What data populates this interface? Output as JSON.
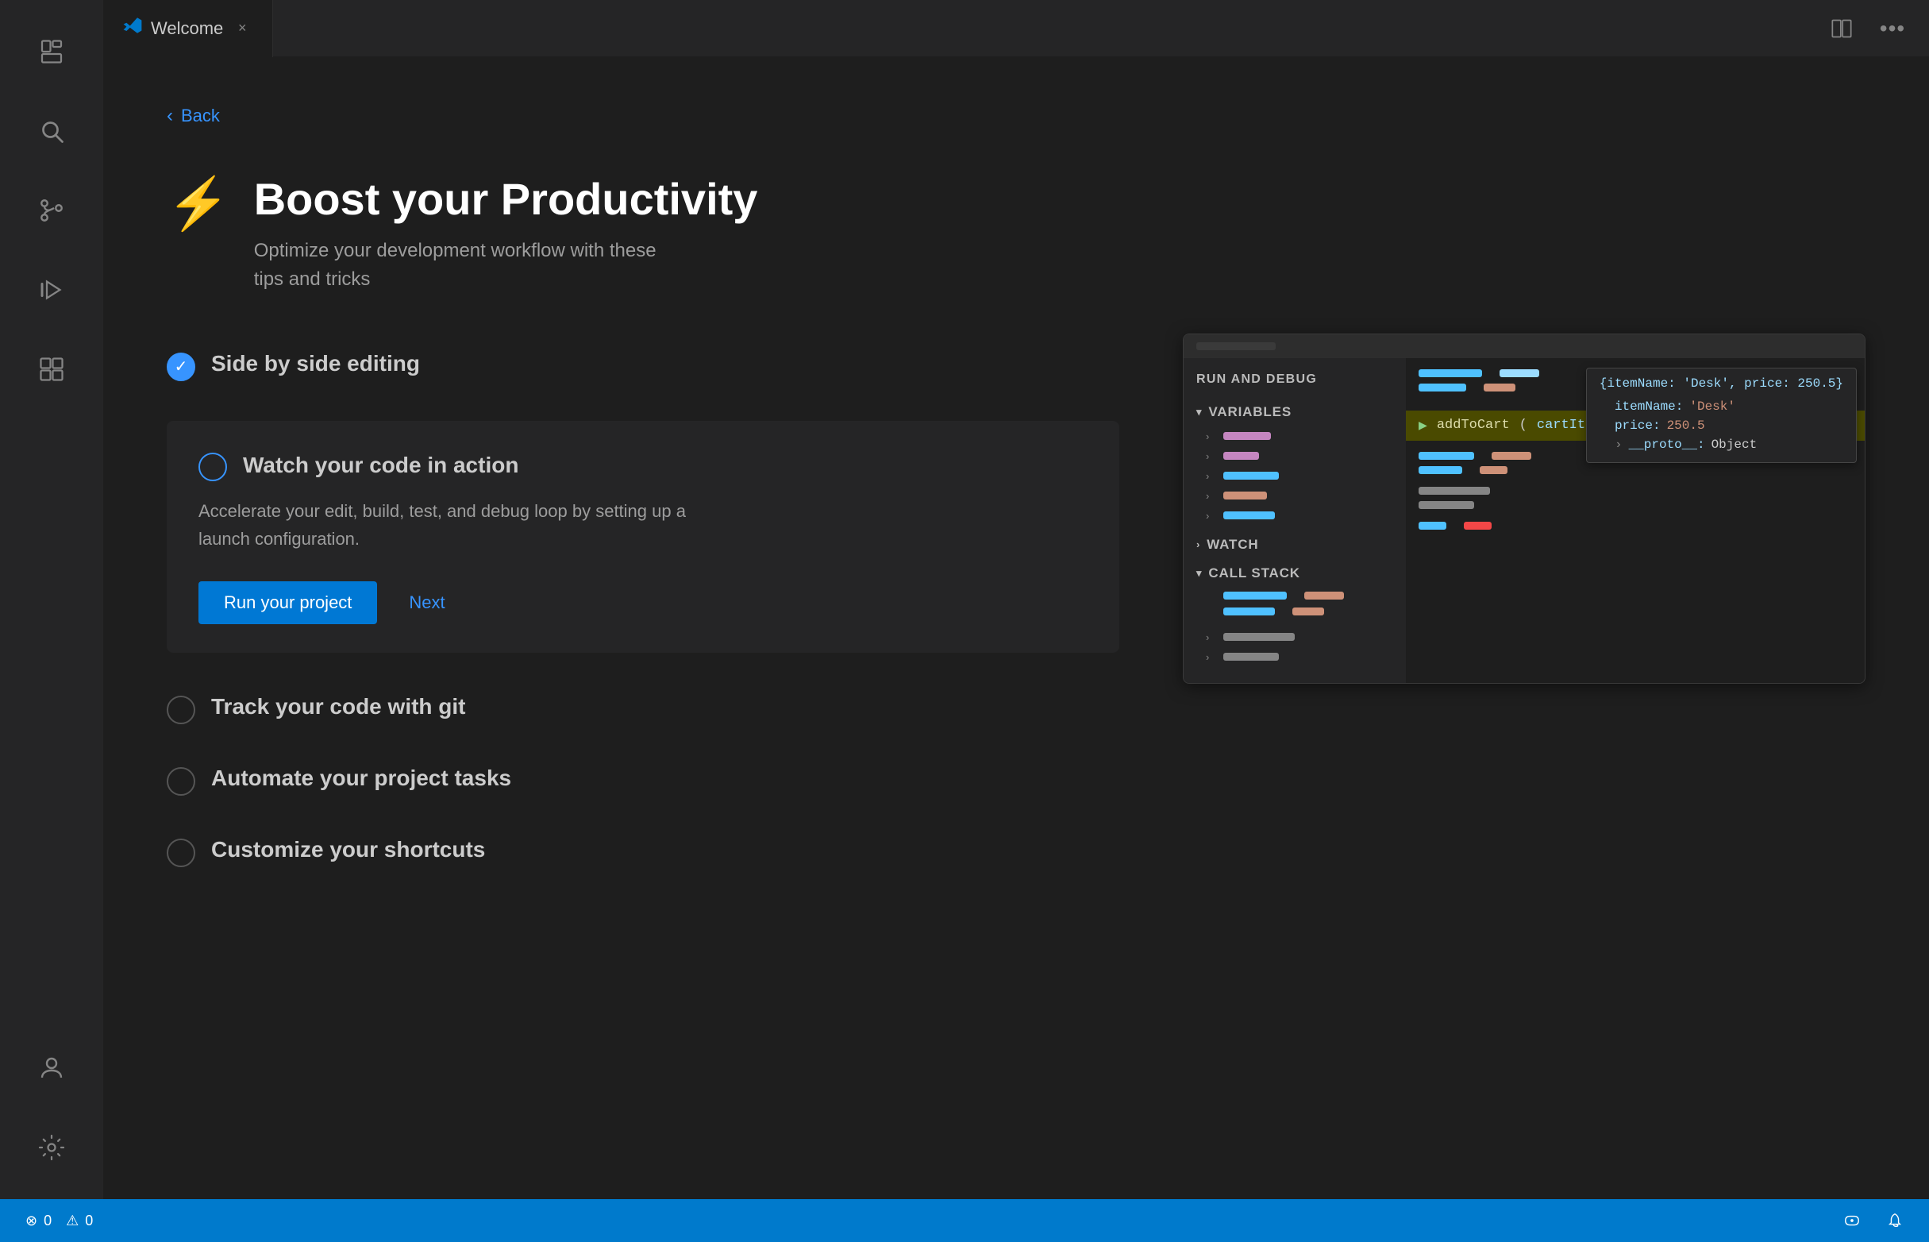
{
  "tab": {
    "icon": "⚡",
    "title": "Welcome",
    "close_label": "×"
  },
  "toolbar": {
    "split_editor": "⊟",
    "more_actions": "⋯"
  },
  "back_link": "Back",
  "page": {
    "icon": "⚡",
    "title": "Boost your Productivity",
    "subtitle_line1": "Optimize your development workflow with these",
    "subtitle_line2": "tips and tricks"
  },
  "checklist": {
    "items": [
      {
        "id": "side-by-side",
        "label": "Side by side editing",
        "checked": true,
        "expanded": false
      },
      {
        "id": "watch-code",
        "label": "Watch your code in action",
        "checked": false,
        "expanded": true,
        "description": "Accelerate your edit, build, test, and debug loop by setting up a\nlaunch configuration.",
        "primary_action": "Run your project",
        "secondary_action": "Next"
      },
      {
        "id": "track-git",
        "label": "Track your code with git",
        "checked": false,
        "expanded": false
      },
      {
        "id": "automate",
        "label": "Automate your project tasks",
        "checked": false,
        "expanded": false
      },
      {
        "id": "shortcuts",
        "label": "Customize your shortcuts",
        "checked": false,
        "expanded": false
      }
    ]
  },
  "debug_panel": {
    "sections": [
      {
        "name": "VARIABLES",
        "vars": [
          {
            "color": "purple",
            "width": 60
          },
          {
            "color": "purple",
            "width": 45
          },
          {
            "color": "blue",
            "width": 70
          },
          {
            "color": "orange",
            "width": 55
          },
          {
            "color": "blue",
            "width": 65
          }
        ]
      },
      {
        "name": "WATCH"
      },
      {
        "name": "CALL STACK",
        "vars": [
          {
            "color": "blue",
            "width": 80,
            "width2": 60,
            "color2": "orange"
          },
          {
            "color": "blue",
            "width": 70,
            "width2": 50,
            "color2": "orange"
          }
        ]
      }
    ],
    "tooltip": {
      "title": "{itemName: 'Desk', price: 250.5}",
      "rows": [
        {
          "key": "itemName:",
          "val": "'Desk'"
        },
        {
          "key": "price:",
          "val": "250.5"
        },
        {
          "key": "__proto__:",
          "val": "Object"
        }
      ]
    },
    "highlight_line": "addToCart(cartItem);",
    "call_stack_lines": [
      {
        "color1": "blue",
        "w1": 80,
        "color2": "orange",
        "w2": 60
      },
      {
        "color1": "blue",
        "w1": 70,
        "color2": "orange",
        "w2": 50
      }
    ],
    "extra_lines": [
      {
        "color1": "gray",
        "w1": 100
      },
      {
        "color1": "gray",
        "w1": 80
      },
      {
        "color1": "blue",
        "w1": 40,
        "color2": "red",
        "w2": 40
      }
    ]
  },
  "activity_bar": {
    "top_items": [
      {
        "id": "explorer",
        "icon": "files"
      },
      {
        "id": "search",
        "icon": "search"
      },
      {
        "id": "source-control",
        "icon": "source-control"
      },
      {
        "id": "run",
        "icon": "run"
      },
      {
        "id": "extensions",
        "icon": "extensions"
      }
    ],
    "bottom_items": [
      {
        "id": "account",
        "icon": "account"
      },
      {
        "id": "settings",
        "icon": "settings"
      }
    ]
  },
  "status_bar": {
    "errors": "0",
    "warnings": "0",
    "error_icon": "⊗",
    "warning_icon": "⚠"
  }
}
